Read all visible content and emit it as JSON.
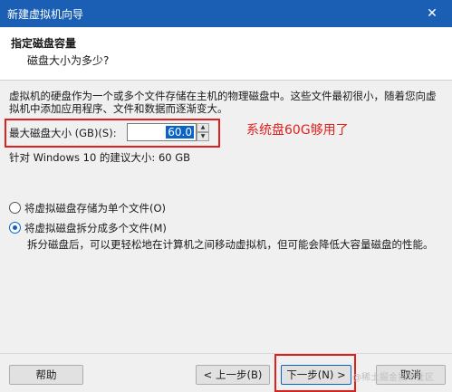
{
  "window": {
    "title": "新建虚拟机向导",
    "close_glyph": "✕"
  },
  "header": {
    "title": "指定磁盘容量",
    "subtitle": "磁盘大小为多少?"
  },
  "description": "虚拟机的硬盘作为一个或多个文件存储在主机的物理磁盘中。这些文件最初很小，随着您向虚拟机中添加应用程序、文件和数据而逐渐变大。",
  "disk_size": {
    "label": "最大磁盘大小 (GB)(S):",
    "value": "60.0",
    "spin_up": "▲",
    "spin_down": "▼"
  },
  "annotation": "系统盘60G够用了",
  "recommendation": "针对 Windows 10 的建议大小: 60 GB",
  "options": {
    "single_file": {
      "label": "将虚拟磁盘存储为单个文件(O)",
      "selected": false
    },
    "split_files": {
      "label": "将虚拟磁盘拆分成多个文件(M)",
      "selected": true
    }
  },
  "split_description": "拆分磁盘后，可以更轻松地在计算机之间移动虚拟机，但可能会降低大容量磁盘的性能。",
  "buttons": {
    "help": "帮助",
    "back": "< 上一步(B)",
    "next": "下一步(N) >",
    "cancel": "取消"
  },
  "watermark": "@稀土掘金技术社区",
  "colors": {
    "titlebar": "#1a5fb4",
    "annotation": "#e0201c",
    "selection": "#0a64c8"
  }
}
